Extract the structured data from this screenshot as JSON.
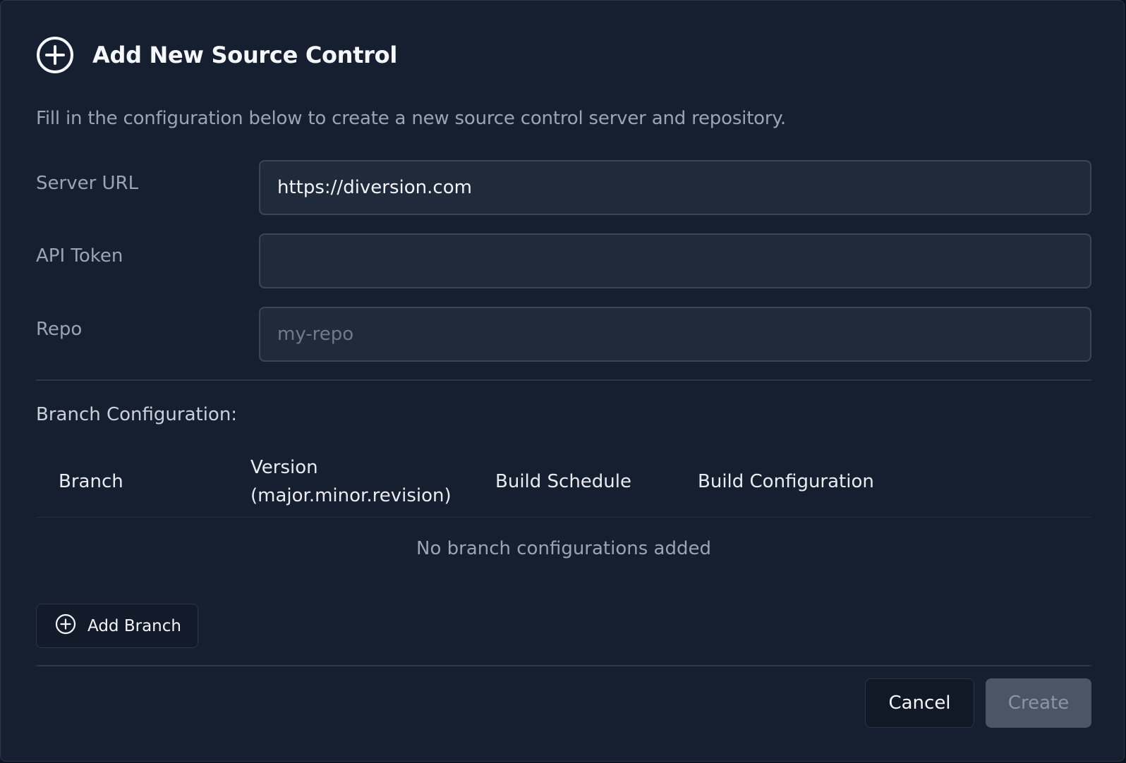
{
  "dialog": {
    "title": "Add New Source Control",
    "title_icon": "plus-circle-icon",
    "description": "Fill in the configuration below to create a new source control server and repository."
  },
  "form": {
    "server_url": {
      "label": "Server URL",
      "value": "https://diversion.com",
      "placeholder": ""
    },
    "api_token": {
      "label": "API Token",
      "value": "",
      "placeholder": ""
    },
    "repo": {
      "label": "Repo",
      "value": "",
      "placeholder": "my-repo"
    }
  },
  "branch_config": {
    "title": "Branch Configuration:",
    "columns": [
      "Branch",
      "Version (major.minor.revision)",
      "Build Schedule",
      "Build Configuration"
    ],
    "version_col_line1": "Version",
    "version_col_line2": "(major.minor.revision)",
    "empty_text": "No branch configurations added",
    "add_button_label": "Add Branch",
    "add_button_icon": "plus-circle-icon"
  },
  "footer": {
    "cancel_label": "Cancel",
    "create_label": "Create"
  },
  "colors": {
    "background": "#161f30",
    "input_bg": "#1f2a3b",
    "create_disabled": "#4b5566"
  }
}
